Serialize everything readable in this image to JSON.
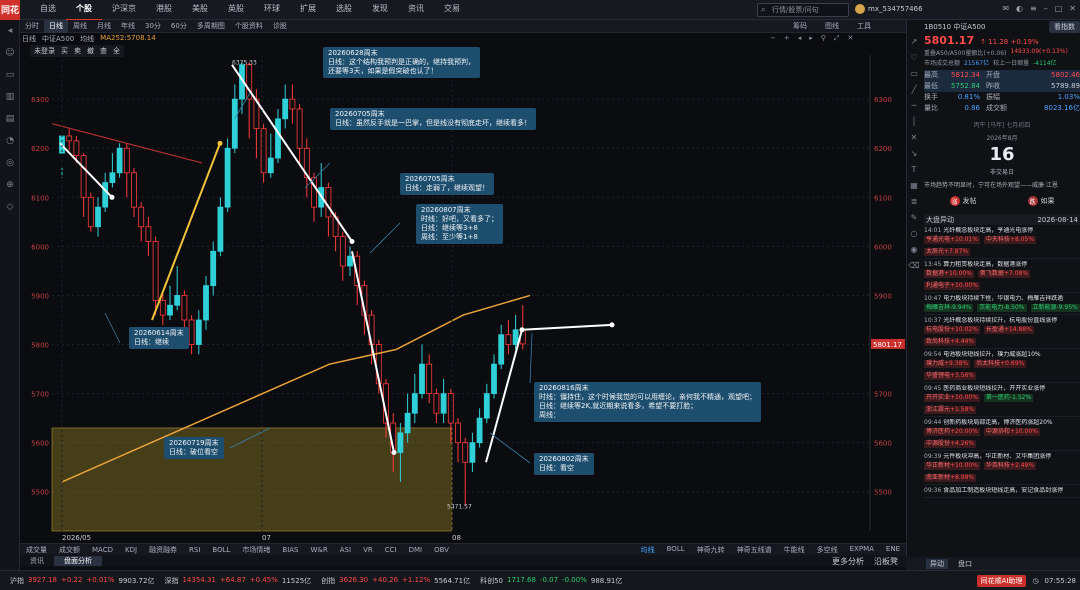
{
  "app": {
    "logo": "同花"
  },
  "topnav": [
    "自选",
    "个股",
    "沪深京",
    "港股",
    "美股",
    "英股",
    "环球",
    "扩展",
    "选股",
    "发现",
    "资讯",
    "交易"
  ],
  "topnav_active": 1,
  "search": {
    "placeholder": "行情/股票/问句"
  },
  "user": {
    "name": "mx_534757466"
  },
  "subbar": [
    "分时",
    "日线",
    "周线",
    "月线",
    "年线",
    "30分",
    "60分",
    "多周期图",
    "个股资料",
    "诊股"
  ],
  "subbar_active": 1,
  "subbar_right": [
    "筹码",
    "图线",
    "工具"
  ],
  "info": {
    "period": "日线",
    "name": "中证A500",
    "avg": "均线",
    "ma": "MA252:5708.14"
  },
  "drawtools": [
    "未登录",
    "买",
    "卖",
    "撤",
    "查",
    "全"
  ],
  "chart_data": {
    "type": "candlestick",
    "x_ticks": [
      "2026/05",
      "07",
      "08"
    ],
    "y_ticks": [
      5500,
      5600,
      5700,
      5800,
      5900,
      6000,
      6100,
      6200,
      6300
    ],
    "y_range": [
      5420,
      6390
    ],
    "high_label": "6375.33",
    "low_label": "5471.57",
    "last_label": "5801.17",
    "candles": [
      [
        6190,
        6225,
        6160,
        6140
      ],
      [
        6225,
        6215,
        6240,
        6195
      ],
      [
        6215,
        6185,
        6225,
        6170
      ],
      [
        6185,
        6100,
        6190,
        6060
      ],
      [
        6100,
        6040,
        6110,
        6030
      ],
      [
        6040,
        6080,
        6100,
        6020
      ],
      [
        6080,
        6130,
        6150,
        6070
      ],
      [
        6130,
        6150,
        6190,
        6120
      ],
      [
        6150,
        6200,
        6210,
        6140
      ],
      [
        6200,
        6150,
        6210,
        6100
      ],
      [
        6150,
        6080,
        6160,
        6060
      ],
      [
        6080,
        6040,
        6090,
        6010
      ],
      [
        6040,
        6010,
        6060,
        5980
      ],
      [
        6010,
        5890,
        6020,
        5860
      ],
      [
        5890,
        5860,
        5910,
        5840
      ],
      [
        5860,
        5880,
        5920,
        5850
      ],
      [
        5880,
        5900,
        5960,
        5870
      ],
      [
        5900,
        5850,
        5910,
        5800
      ],
      [
        5850,
        5800,
        5860,
        5780
      ],
      [
        5800,
        5850,
        5870,
        5780
      ],
      [
        5850,
        5920,
        5940,
        5830
      ],
      [
        5920,
        5990,
        6010,
        5900
      ],
      [
        5990,
        6080,
        6100,
        5980
      ],
      [
        6080,
        6200,
        6220,
        6070
      ],
      [
        6200,
        6300,
        6330,
        6190
      ],
      [
        6300,
        6370,
        6375,
        6270
      ],
      [
        6370,
        6300,
        6375,
        6220
      ],
      [
        6300,
        6240,
        6320,
        6180
      ],
      [
        6240,
        6150,
        6250,
        6130
      ],
      [
        6150,
        6180,
        6230,
        6140
      ],
      [
        6180,
        6260,
        6280,
        6170
      ],
      [
        6260,
        6300,
        6330,
        6240
      ],
      [
        6300,
        6280,
        6330,
        6250
      ],
      [
        6280,
        6200,
        6290,
        6170
      ],
      [
        6200,
        6140,
        6220,
        6100
      ],
      [
        6140,
        6080,
        6150,
        6050
      ],
      [
        6080,
        6120,
        6170,
        6060
      ],
      [
        6120,
        6060,
        6130,
        6020
      ],
      [
        6060,
        6020,
        6070,
        5990
      ],
      [
        6020,
        5960,
        6030,
        5930
      ],
      [
        5960,
        5980,
        6000,
        5940
      ],
      [
        5980,
        5920,
        5990,
        5880
      ],
      [
        5920,
        5860,
        5930,
        5820
      ],
      [
        5860,
        5800,
        5870,
        5760
      ],
      [
        5800,
        5720,
        5810,
        5700
      ],
      [
        5720,
        5640,
        5730,
        5610
      ],
      [
        5640,
        5580,
        5660,
        5540
      ],
      [
        5580,
        5620,
        5640,
        5520
      ],
      [
        5620,
        5660,
        5700,
        5600
      ],
      [
        5660,
        5700,
        5740,
        5640
      ],
      [
        5700,
        5760,
        5800,
        5690
      ],
      [
        5760,
        5700,
        5780,
        5680
      ],
      [
        5700,
        5660,
        5710,
        5640
      ],
      [
        5660,
        5700,
        5730,
        5640
      ],
      [
        5700,
        5640,
        5710,
        5600
      ],
      [
        5640,
        5600,
        5650,
        5560
      ],
      [
        5600,
        5560,
        5610,
        5471.57
      ],
      [
        5560,
        5600,
        5620,
        5540
      ],
      [
        5600,
        5650,
        5670,
        5590
      ],
      [
        5650,
        5700,
        5720,
        5640
      ],
      [
        5700,
        5760,
        5780,
        5690
      ],
      [
        5760,
        5820,
        5840,
        5750
      ],
      [
        5820,
        5800,
        5850,
        5780
      ],
      [
        5800,
        5830,
        5860,
        5790
      ],
      [
        5830,
        5801.17,
        5880,
        5790
      ]
    ],
    "ma_line": [
      [
        0,
        5520
      ],
      [
        1,
        5580
      ],
      [
        2,
        5640
      ],
      [
        3,
        5700
      ],
      [
        4,
        5760
      ],
      [
        5,
        5790
      ],
      [
        6,
        5860
      ],
      [
        7,
        5900
      ]
    ]
  },
  "notes": [
    {
      "id": "n0628",
      "lines": [
        "20260628周末",
        "日线：这个结构我预判是正确的，继持我预判，",
        "还要等3天，如果是假突破也认了！"
      ]
    },
    {
      "id": "n0705a",
      "lines": [
        "20260705周末",
        "日线：虽然反手就是一巴掌，但是线没有彻底走坏，继续看多！"
      ]
    },
    {
      "id": "n0705b",
      "lines": [
        "20260705周末",
        "日线：走弱了，继续观望！"
      ]
    },
    {
      "id": "n0807",
      "lines": [
        "20260807周末",
        "时线：好吧，又看多了；",
        "日线：继续等3+8",
        "周线：至少等1+8"
      ]
    },
    {
      "id": "n0614",
      "lines": [
        "20260614周末",
        "日线：继续"
      ]
    },
    {
      "id": "n0719",
      "lines": [
        "20260719周末",
        "日线：破位看空"
      ]
    },
    {
      "id": "n0816",
      "lines": [
        "20260816周末",
        "时线：僵持住，这个时候我觉的可以用缠论，亲何我不精通，观望吧；",
        "日线：继续等2K,就近期来说看多，希望不要打脸；",
        "周线："
      ]
    },
    {
      "id": "n0802",
      "lines": [
        "20260802周末",
        "日线：看空"
      ]
    }
  ],
  "indicators": [
    "成交量",
    "成交额",
    "MACD",
    "KDJ",
    "融资融券",
    "RSI",
    "BOLL",
    "市场情绪",
    "BIAS",
    "W&R",
    "ASI",
    "VR",
    "CCI",
    "DMI",
    "OBV"
  ],
  "indicators_right": [
    "均线",
    "BOLL",
    "神奇九转",
    "神奇五线谱",
    "牛能线",
    "多空线",
    "EXPMA",
    "ENE"
  ],
  "bottom_tabs": [
    "资讯",
    "盘面分析"
  ],
  "bottom_tabs_right": [
    "更多分析",
    "沿板凳"
  ],
  "status": [
    {
      "name": "沪指",
      "price": "3927.18",
      "chg": "+0.22",
      "pct": "+0.01%",
      "vol": "9903.72亿",
      "dir": "up"
    },
    {
      "name": "深指",
      "price": "14354.31",
      "chg": "+64.87",
      "pct": "+0.45%",
      "vol": "11525亿",
      "dir": "up"
    },
    {
      "name": "创指",
      "price": "3626.30",
      "chg": "+40.26",
      "pct": "+1.12%",
      "vol": "5564.71亿",
      "dir": "up"
    },
    {
      "name": "科创50",
      "price": "1717.68",
      "chg": "-0.07",
      "pct": "-0.00%",
      "vol": "988.91亿",
      "dir": "dn"
    }
  ],
  "status_right": {
    "btn": "同花顺AI助理",
    "time": "07:55:28"
  },
  "rp": {
    "code": "1B0510",
    "name": "中证A500",
    "tag": "看指数",
    "price": "5801.17",
    "arrow": "↑",
    "chg": "11.28",
    "pct": "+0.19%",
    "line1": "重叠A50/A500量额比(+0.06)",
    "line1b": "14933.09(+0.13%)",
    "line2a": "市场成交总额",
    "line2b": "21567亿",
    "line2c": "较上一日缩量",
    "line2d": "-4114亿",
    "rows": [
      [
        "最高",
        "5812.34",
        "开盘",
        "5802.46"
      ],
      [
        "最低",
        "5752.84",
        "昨收",
        "5789.89"
      ],
      [
        "换手",
        "0.81%",
        "振幅",
        "1.03%"
      ],
      [
        "量比",
        "0.86",
        "成交额",
        "8023.16亿"
      ]
    ],
    "cal_top": "丙午 [马年] 七月初四",
    "cal_month": "2026年8月",
    "cal_day": "16",
    "cal_note": "非交易日",
    "cal_text": "市场趋势不明显时，宁可在场外观望——威廉·江恩",
    "vote_up": "发帖",
    "vote_dn": "如果",
    "news_title": "大盘异动",
    "news_date": "2026-08-14",
    "news": [
      {
        "time": "14:01",
        "title": "光纤概念板块走高，亨通光电涨停",
        "chips": [
          [
            "亨通光电",
            "+10.01%",
            "up"
          ],
          [
            "中天科技",
            "+8.05%",
            "up"
          ],
          [
            "太辰光",
            "+7.87%",
            "up"
          ]
        ]
      },
      {
        "time": "13:45",
        "title": "算力租赁板块走高，数据港涨停",
        "chips": [
          [
            "数据港",
            "+10.00%",
            "up"
          ],
          [
            "奥飞数据",
            "+7.08%",
            "up"
          ],
          [
            "利通电子",
            "+10.00%",
            "up"
          ]
        ]
      },
      {
        "time": "10:47",
        "title": "电力板块持续下挫，华银电力、梅雁吉祥跌逾",
        "chips": [
          [
            "梅雁吉祥",
            "-9.94%",
            "dn"
          ],
          [
            "京能电力",
            "-8.50%",
            "dn"
          ],
          [
            "立新能源",
            "-9.95%",
            "dn"
          ]
        ]
      },
      {
        "time": "10:37",
        "title": "光纤概念板块持续拉升，杭电股份直线涨停",
        "chips": [
          [
            "杭电股份",
            "+10.02%",
            "up"
          ],
          [
            "长盈通",
            "+14.88%",
            "up"
          ],
          [
            "致尚科技",
            "+4.44%",
            "up"
          ]
        ]
      },
      {
        "time": "09:54",
        "title": "电池板块短线拉升，璞力威涨超10%",
        "chips": [
          [
            "璞力威",
            "+9.38%",
            "up"
          ],
          [
            "尚太科技",
            "+0.69%",
            "up"
          ],
          [
            "华盛锂电",
            "+3.56%",
            "up"
          ]
        ]
      },
      {
        "time": "09:45",
        "title": "医药商业板块短线拉升，开开实业涨停",
        "chips": [
          [
            "开开实业",
            "+10.00%",
            "up"
          ],
          [
            "第一医药",
            "-1.52%",
            "dn"
          ],
          [
            "浙江震元",
            "+1.58%",
            "up"
          ]
        ]
      },
      {
        "time": "09:44",
        "title": "创新药板块局部走高，博济医药涨超20%",
        "chips": [
          [
            "博济医药",
            "+20.00%",
            "up"
          ],
          [
            "中源协和",
            "+10.00%",
            "up"
          ],
          [
            "中源股份",
            "+4.26%",
            "up"
          ]
        ]
      },
      {
        "time": "09:39",
        "title": "元件板块冲高，华正新材、艾华集团涨停",
        "chips": [
          [
            "华正新材",
            "+10.00%",
            "up"
          ],
          [
            "华英科技",
            "+2.49%",
            "up"
          ],
          [
            "南亚新材",
            "+8.98%",
            "up"
          ]
        ]
      },
      {
        "time": "09:36",
        "title": "食品加工制造板块短线走高，安记食品封涨停",
        "chips": []
      }
    ],
    "rp_tabs": [
      "异动",
      "盘口"
    ]
  }
}
